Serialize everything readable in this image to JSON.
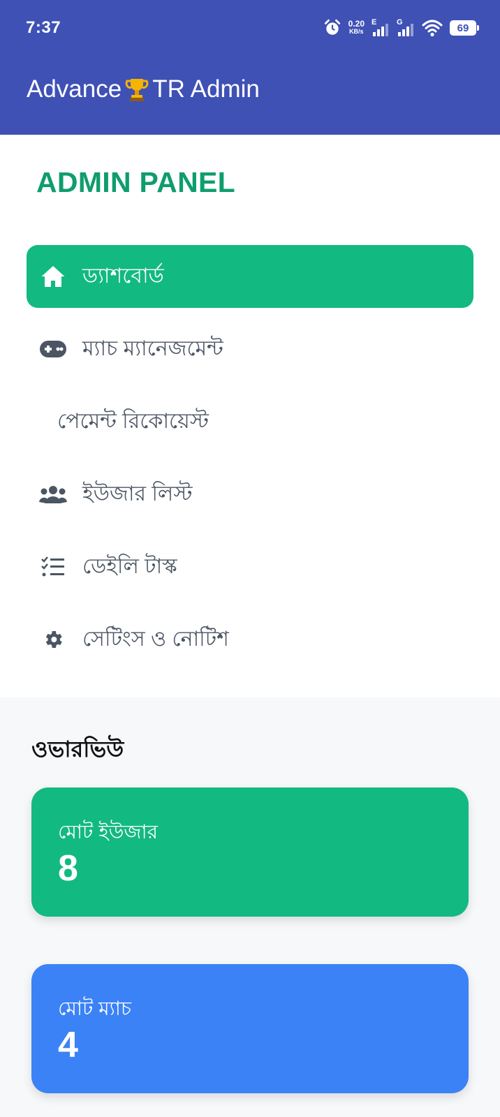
{
  "status_bar": {
    "time": "7:37",
    "net_speed_value": "0.20",
    "net_speed_unit": "KB/s",
    "sim1_type": "E",
    "sim2_type": "G",
    "battery": "69"
  },
  "app_bar": {
    "title_prefix": "Advance",
    "title_suffix": "TR Admin",
    "color": "#3f51b5"
  },
  "menu": {
    "heading": "ADMIN PANEL",
    "items": [
      {
        "label": "ড্যাশবোর্ড",
        "icon": "home-icon",
        "active": true
      },
      {
        "label": "ম্যাচ ম্যানেজমেন্ট",
        "icon": "gamepad-icon",
        "active": false
      },
      {
        "label": "পেমেন্ট রিকোয়েস্ট",
        "icon": "",
        "active": false
      },
      {
        "label": "ইউজার লিস্ট",
        "icon": "users-icon",
        "active": false
      },
      {
        "label": "ডেইলি টাস্ক",
        "icon": "checklist-icon",
        "active": false
      },
      {
        "label": "সেটিংস ও নোটিশ",
        "icon": "gear-icon",
        "active": false
      }
    ],
    "accent": "#12b981"
  },
  "overview": {
    "title": "ওভারভিউ",
    "cards": [
      {
        "label": "মোট ইউজার",
        "value": "8",
        "color": "#12b981"
      },
      {
        "label": "মোট ম্যাচ",
        "value": "4",
        "color": "#3b82f6"
      }
    ]
  }
}
